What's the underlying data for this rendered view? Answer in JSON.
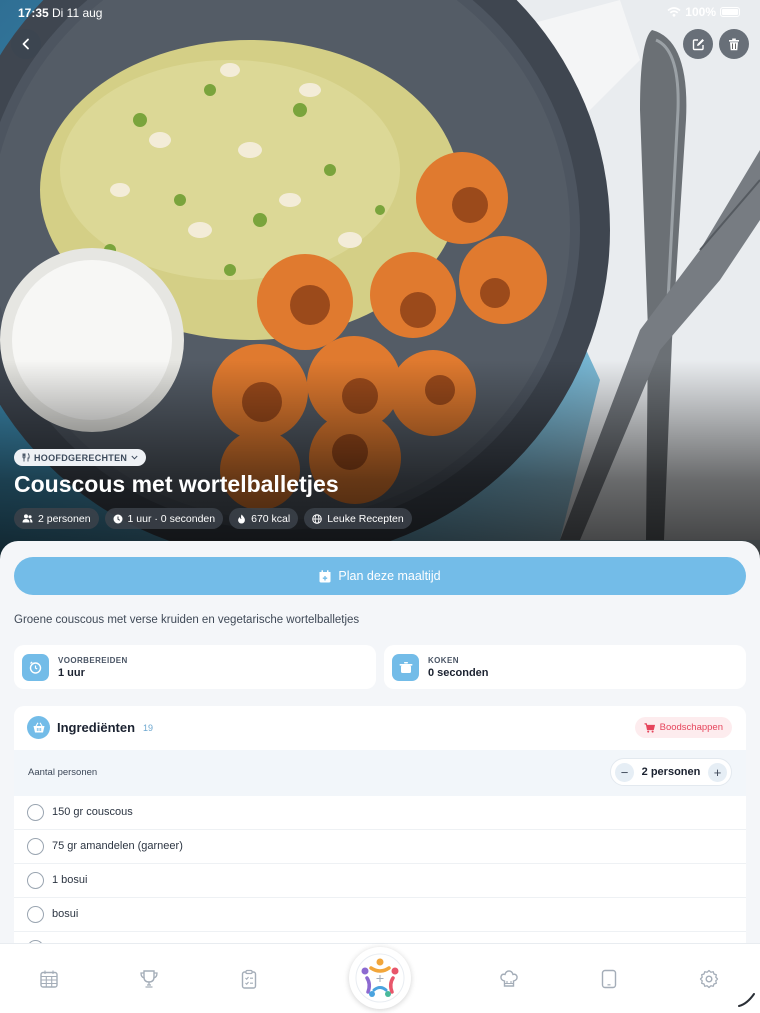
{
  "status_bar": {
    "time": "17:35",
    "date": "Di 11 aug",
    "battery": "100%"
  },
  "recipe": {
    "category": "HOOFDGERECHTEN",
    "title": "Couscous met wortelballetjes",
    "meta": {
      "persons": "2 personen",
      "duration": "1 uur · 0 seconden",
      "calories": "670 kcal",
      "source": "Leuke Recepten"
    },
    "plan_button": "Plan deze maaltijd",
    "description": "Groene couscous met verse kruiden en vegetarische wortelballetjes",
    "prep": {
      "label": "VOORBEREIDEN",
      "value": "1 uur"
    },
    "cook": {
      "label": "KOKEN",
      "value": "0 seconden"
    }
  },
  "ingredients": {
    "title": "Ingrediënten",
    "count": "19",
    "shopping_button": "Boodschappen",
    "persons_label": "Aantal personen",
    "persons_value": "2 personen",
    "decrement": "−",
    "increment": "+",
    "items": [
      "150 gr couscous",
      "75 gr amandelen (garneer)",
      "1 bosui",
      "bosui"
    ]
  },
  "colors": {
    "accent": "#73bce8",
    "shopping": "#e6455c",
    "background": "#f4f6f9"
  },
  "icons": {
    "tabs": [
      "calendar-icon",
      "trophy-icon",
      "checklist-icon",
      "chef-hat-icon",
      "tablet-icon",
      "settings-icon"
    ]
  }
}
